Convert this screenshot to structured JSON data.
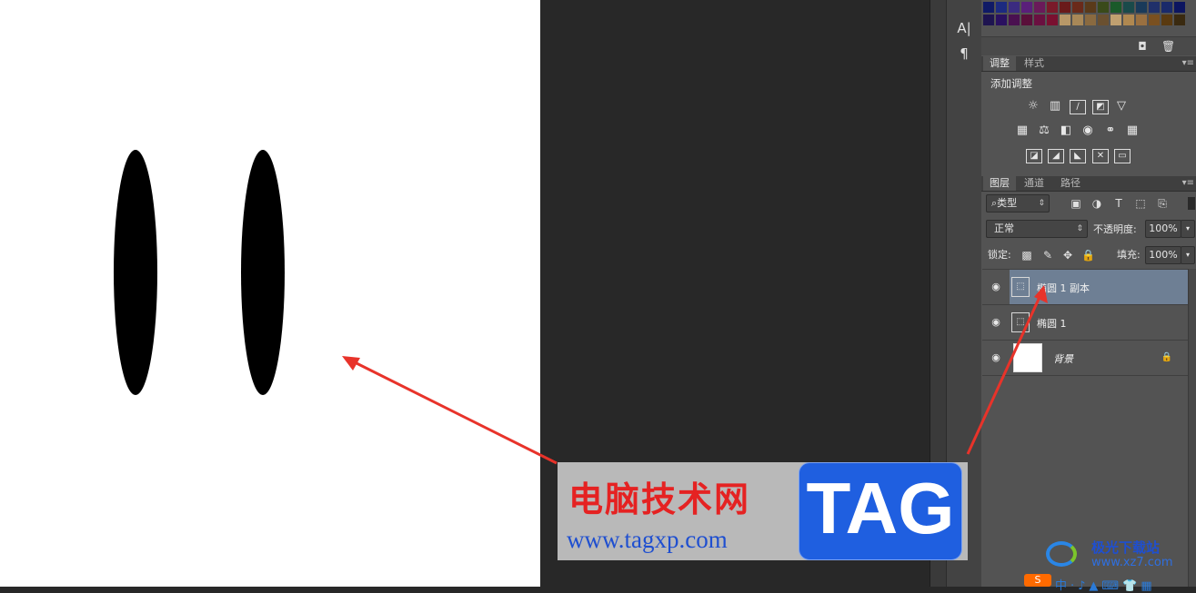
{
  "tools": {
    "type_tool": "A|",
    "paragraph_tool": "¶"
  },
  "swatch_colors": [
    [
      "#0f1a66",
      "#1c2a80",
      "#3b2b80",
      "#5a1f7a",
      "#6a1a5a",
      "#7a1a2a",
      "#6a1a1a",
      "#6a2a1a",
      "#5a3a1a",
      "#3a4a1a",
      "#1a5a2a",
      "#1a4a4a",
      "#1a3a5a",
      "#20306a",
      "#1a2a6a",
      "#0c1560"
    ],
    [
      "#1e1450",
      "#2a1060",
      "#4a1050",
      "#5a0f3a",
      "#6a1040",
      "#7a1030",
      "#b89868",
      "#a88858",
      "#8a6a40",
      "#6a5030",
      "#c0a070",
      "#b08850",
      "#9a7040",
      "#7a5020",
      "#5a3a10",
      "#3a2a10"
    ]
  ],
  "adjustments_panel": {
    "tabs": [
      "调整",
      "样式"
    ],
    "title": "添加调整",
    "icons_row1": [
      "brightness-icon",
      "levels-icon",
      "curves-icon",
      "exposure-icon",
      "vibrance-icon"
    ],
    "icons_row2": [
      "hue-saturation-icon",
      "color-balance-icon",
      "black-white-icon",
      "photo-filter-icon",
      "channel-mixer-icon",
      "color-lookup-icon"
    ],
    "icons_row3": [
      "invert-icon",
      "posterize-icon",
      "threshold-icon",
      "selective-color-icon",
      "gradient-map-icon"
    ]
  },
  "layers_panel": {
    "tabs": [
      "图层",
      "通道",
      "路径"
    ],
    "filter_label": "类型",
    "blend_mode": "正常",
    "opacity_label": "不透明度:",
    "opacity_value": "100%",
    "lock_label": "锁定:",
    "fill_label": "填充:",
    "fill_value": "100%",
    "layers": [
      {
        "name": "椭圆 1 副本",
        "selected": true,
        "type": "shape"
      },
      {
        "name": "椭圆 1",
        "selected": false,
        "type": "shape"
      },
      {
        "name": "背景",
        "selected": false,
        "type": "background",
        "locked": true
      }
    ]
  },
  "watermark": {
    "title": "电脑技术网",
    "url": "www.tagxp.com",
    "tag": "TAG"
  },
  "corner_brand": {
    "name": "极光下载站",
    "url": "www.xz7.com"
  },
  "annotation_color": "#e8332a"
}
